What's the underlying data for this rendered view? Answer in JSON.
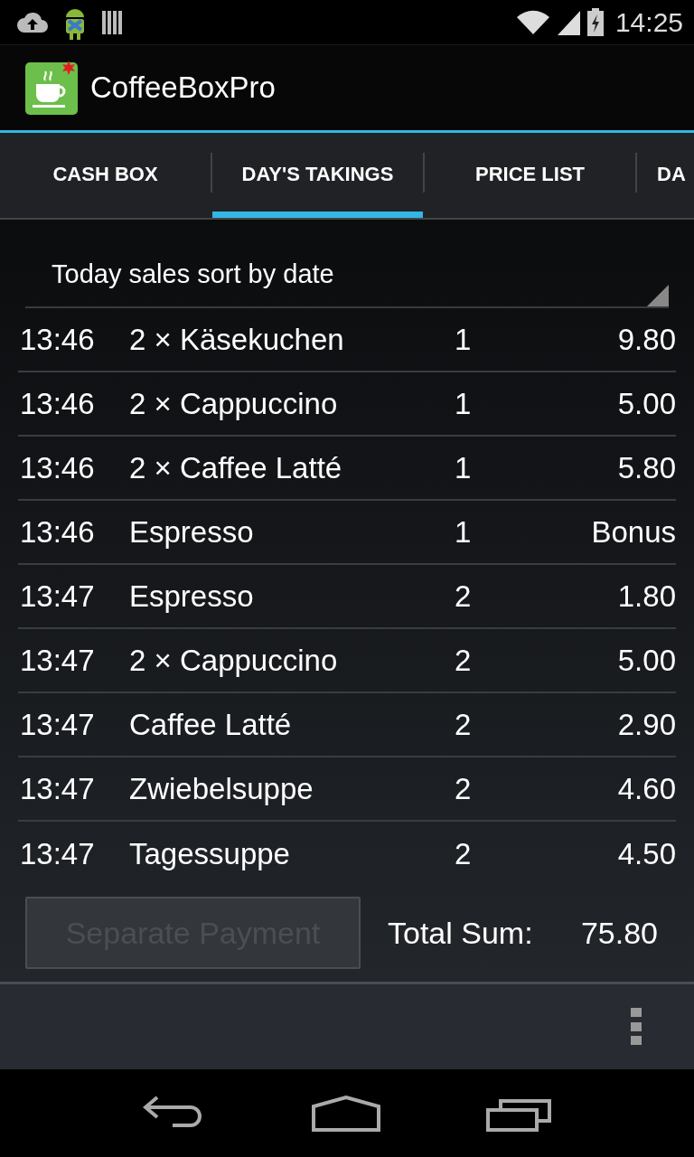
{
  "status_bar": {
    "time": "14:25"
  },
  "action_bar": {
    "title": "CoffeeBoxPro"
  },
  "tabs": [
    {
      "label": "CASH BOX",
      "selected": false
    },
    {
      "label": "DAY'S TAKINGS",
      "selected": true
    },
    {
      "label": "PRICE LIST",
      "selected": false
    },
    {
      "label": "DA",
      "selected": false
    }
  ],
  "spinner": {
    "value": "Today sales sort by date"
  },
  "sales": [
    {
      "time": "13:46",
      "item": "2 × Käsekuchen",
      "column_3": "1",
      "price": "9.80"
    },
    {
      "time": "13:46",
      "item": "2 × Cappuccino",
      "column_3": "1",
      "price": "5.00"
    },
    {
      "time": "13:46",
      "item": "2 × Caffee Latté",
      "column_3": "1",
      "price": "5.80"
    },
    {
      "time": "13:46",
      "item": "Espresso",
      "column_3": "1",
      "price": "Bonus"
    },
    {
      "time": "13:47",
      "item": "Espresso",
      "column_3": "2",
      "price": "1.80"
    },
    {
      "time": "13:47",
      "item": "2 × Cappuccino",
      "column_3": "2",
      "price": "5.00"
    },
    {
      "time": "13:47",
      "item": "Caffee Latté",
      "column_3": "2",
      "price": "2.90"
    },
    {
      "time": "13:47",
      "item": "Zwiebelsuppe",
      "column_3": "2",
      "price": "4.60"
    },
    {
      "time": "13:47",
      "item": "Tagessuppe",
      "column_3": "2",
      "price": "4.50"
    }
  ],
  "footer": {
    "button": {
      "label": "Separate Payment",
      "disabled": true
    },
    "total_label": "Total Sum:",
    "total_value": "75.80"
  }
}
